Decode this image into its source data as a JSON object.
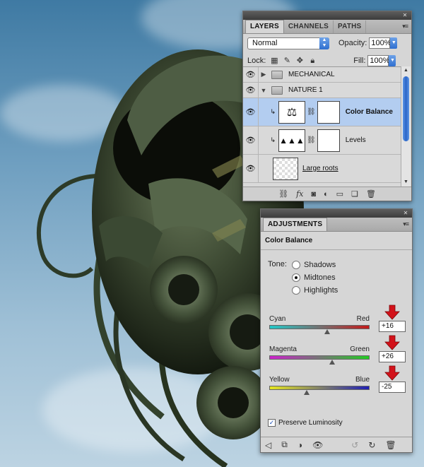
{
  "layers_panel": {
    "tabs": [
      {
        "label": "LAYERS"
      },
      {
        "label": "CHANNELS"
      },
      {
        "label": "PATHS"
      }
    ],
    "blend_mode": "Normal",
    "opacity_label": "Opacity:",
    "opacity_value": "100%",
    "lock_label": "Lock:",
    "fill_label": "Fill:",
    "fill_value": "100%",
    "layers": [
      {
        "name": "MECHANICAL",
        "type": "group",
        "expanded": false
      },
      {
        "name": "NATURE 1",
        "type": "group",
        "expanded": true
      },
      {
        "name": "Color Balance",
        "type": "adjustment",
        "icon": "balance-scale-icon",
        "selected": true
      },
      {
        "name": "Levels",
        "type": "adjustment",
        "icon": "histogram-icon",
        "selected": false
      },
      {
        "name": "Large roots",
        "type": "pixel",
        "selected": false
      }
    ],
    "footer_icons": [
      "link-icon",
      "fx-icon",
      "mask-icon",
      "adjustment-icon",
      "folder-icon",
      "new-layer-icon",
      "trash-icon"
    ]
  },
  "adjustments_panel": {
    "tab": "ADJUSTMENTS",
    "title": "Color Balance",
    "tone_label": "Tone:",
    "tones": [
      {
        "label": "Shadows",
        "selected": false
      },
      {
        "label": "Midtones",
        "selected": true
      },
      {
        "label": "Highlights",
        "selected": false
      }
    ],
    "sliders": [
      {
        "left": "Cyan",
        "right": "Red",
        "value": "+16",
        "fraction": 0.58,
        "left_color": "#22c8c8",
        "right_color": "#c41a1a"
      },
      {
        "left": "Magenta",
        "right": "Green",
        "value": "+26",
        "fraction": 0.63,
        "left_color": "#cc22cc",
        "right_color": "#22cc22"
      },
      {
        "left": "Yellow",
        "right": "Blue",
        "value": "-25",
        "fraction": 0.375,
        "left_color": "#e6e61e",
        "right_color": "#1e1eb4"
      }
    ],
    "preserve_luminosity_label": "Preserve Luminosity",
    "preserve_luminosity_checked": true,
    "footer_icons": [
      "back-arrow-icon",
      "clip-icon",
      "visibility-icon",
      "eye-icon",
      "previous-state-icon",
      "reset-icon",
      "trash-icon"
    ]
  },
  "colors": {
    "selection": "#b3cdf0",
    "accent_blue": "#2f6fd0",
    "annotation_red": "#d2121a"
  }
}
